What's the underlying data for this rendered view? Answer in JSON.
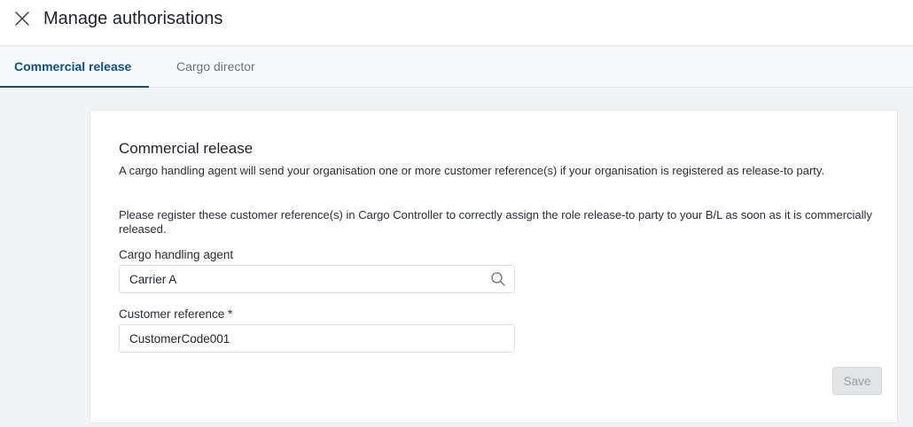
{
  "header": {
    "title": "Manage authorisations",
    "close_icon": "close-icon"
  },
  "tabs": [
    {
      "label": "Commercial release",
      "active": true
    },
    {
      "label": "Cargo director",
      "active": false
    }
  ],
  "card": {
    "title": "Commercial release",
    "paragraph_1": "A cargo handling agent will send your organisation one or more customer reference(s) if your organisation is registered as release-to party.",
    "paragraph_2": "Please register these customer reference(s) in Cargo Controller to correctly assign the role release-to party to your B/L as soon as it is commercially released.",
    "fields": {
      "agent": {
        "label": "Cargo handling agent",
        "value": "Carrier A",
        "icon": "search-icon"
      },
      "customer_reference": {
        "label": "Customer reference *",
        "value": "CustomerCode001"
      }
    },
    "save_label": "Save",
    "save_disabled": true
  },
  "colors": {
    "accent": "#0b4f8c",
    "background": "#f2f3f5",
    "disabled_button": "#e2e4e7"
  }
}
